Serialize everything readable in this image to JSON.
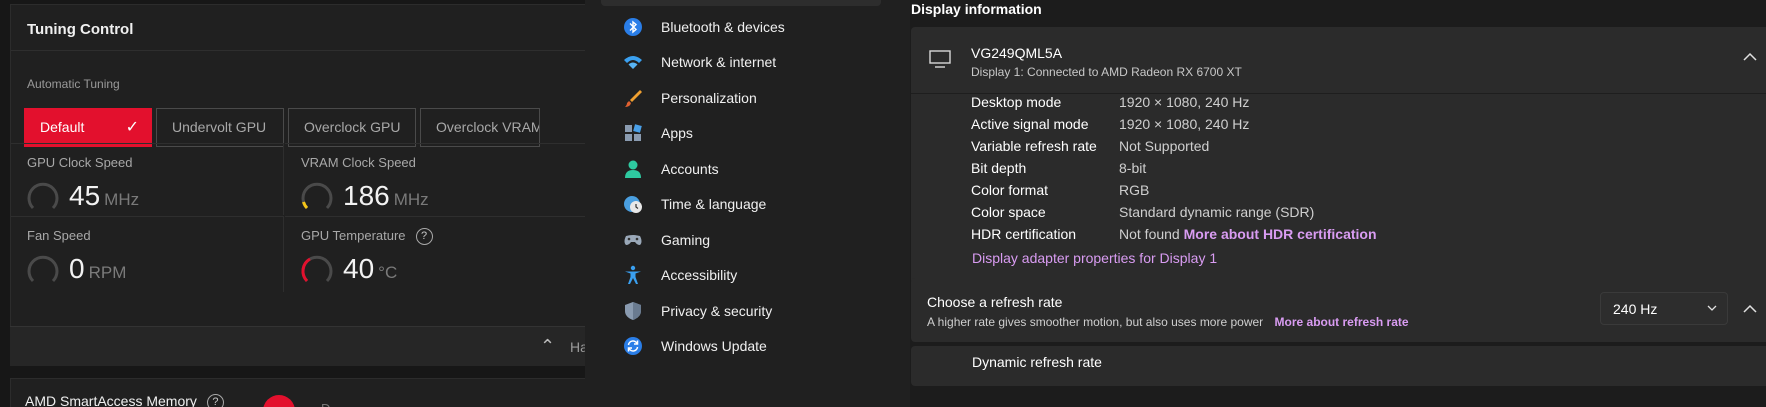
{
  "tuning": {
    "title": "Tuning Control",
    "automatic_label": "Automatic Tuning",
    "buttons": [
      {
        "label": "Default",
        "active": true
      },
      {
        "label": "Undervolt GPU",
        "active": false
      },
      {
        "label": "Overclock GPU",
        "active": false
      },
      {
        "label": "Overclock VRAM",
        "active": false
      }
    ],
    "metrics": [
      {
        "label": "GPU Clock Speed",
        "value": "45",
        "unit": "MHz"
      },
      {
        "label": "VRAM Clock Speed",
        "value": "186",
        "unit": "MHz"
      },
      {
        "label": "Fan Speed",
        "value": "0",
        "unit": "RPM"
      },
      {
        "label": "GPU Temperature",
        "value": "40",
        "unit": "°C"
      }
    ],
    "help_glyph": "?",
    "collapse_text": "Ha",
    "smart_access": {
      "title": "AMD SmartAccess Memory",
      "next_text": "D"
    },
    "accent_color": "#e3102d"
  },
  "sidebar": {
    "items": [
      {
        "label": "Bluetooth & devices",
        "icon": "bluetooth-icon"
      },
      {
        "label": "Network & internet",
        "icon": "wifi-icon"
      },
      {
        "label": "Personalization",
        "icon": "brush-icon"
      },
      {
        "label": "Apps",
        "icon": "apps-icon"
      },
      {
        "label": "Accounts",
        "icon": "account-icon"
      },
      {
        "label": "Time & language",
        "icon": "clock-globe-icon"
      },
      {
        "label": "Gaming",
        "icon": "gamepad-icon"
      },
      {
        "label": "Accessibility",
        "icon": "accessibility-icon"
      },
      {
        "label": "Privacy & security",
        "icon": "shield-icon"
      },
      {
        "label": "Windows Update",
        "icon": "update-icon"
      }
    ]
  },
  "display": {
    "heading": "Display information",
    "monitor": {
      "name": "VG249QML5A",
      "subtitle": "Display 1: Connected to AMD Radeon RX 6700 XT"
    },
    "rows": [
      {
        "key": "Desktop mode",
        "value": "1920 × 1080, 240 Hz"
      },
      {
        "key": "Active signal mode",
        "value": "1920 × 1080, 240 Hz"
      },
      {
        "key": "Variable refresh rate",
        "value": "Not Supported"
      },
      {
        "key": "Bit depth",
        "value": "8-bit"
      },
      {
        "key": "Color format",
        "value": "RGB"
      },
      {
        "key": "Color space",
        "value": "Standard dynamic range (SDR)"
      },
      {
        "key": "HDR certification",
        "value": "Not found",
        "link": "More about HDR certification"
      }
    ],
    "adapter_link": "Display adapter properties for Display 1",
    "refresh": {
      "title": "Choose a refresh rate",
      "subtitle": "A higher rate gives smoother motion, but also uses more power",
      "link": "More about refresh rate",
      "selected": "240 Hz"
    },
    "dynamic_refresh_title": "Dynamic refresh rate",
    "link_color": "#d99cf2"
  }
}
